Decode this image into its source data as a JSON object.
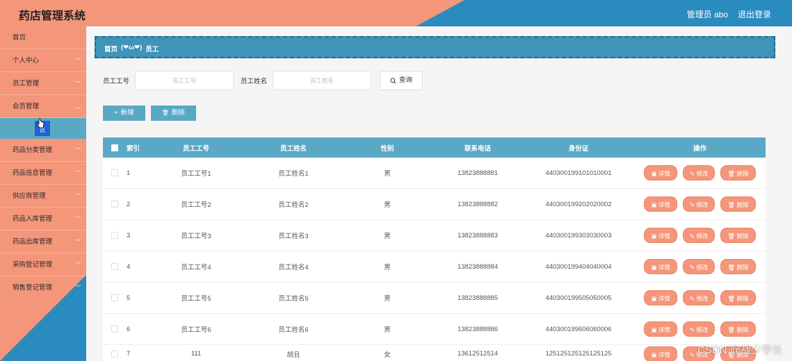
{
  "app": {
    "title": "药店管理系统"
  },
  "header": {
    "user_label": "管理员 abo",
    "logout_label": "退出登录"
  },
  "sidebar": {
    "items": [
      {
        "label": "首页",
        "has_children": false
      },
      {
        "label": "个人中心",
        "has_children": true
      },
      {
        "label": "员工管理",
        "has_children": true
      },
      {
        "label": "会员管理",
        "has_children": true
      },
      {
        "label": "药品分类管理",
        "has_children": true
      },
      {
        "label": "药品信息管理",
        "has_children": true
      },
      {
        "label": "供应商管理",
        "has_children": true
      },
      {
        "label": "药品入库管理",
        "has_children": true
      },
      {
        "label": "药品出库管理",
        "has_children": true
      },
      {
        "label": "采购登记管理",
        "has_children": true
      },
      {
        "label": "销售登记管理",
        "has_children": true
      }
    ],
    "active_sub_label": "员"
  },
  "breadcrumb": {
    "home": "首页",
    "separator": "(❤ω❤)",
    "current": "员工"
  },
  "search": {
    "no_label": "员工工号",
    "no_placeholder": "员工工号",
    "name_label": "员工姓名",
    "name_placeholder": "员工姓名",
    "button_icon": "search-icon",
    "button_label": "查询"
  },
  "actions": {
    "add_label": "新增",
    "add_icon": "+",
    "delete_label": "删除",
    "delete_icon": "🗑"
  },
  "table": {
    "columns": [
      "索引",
      "员工工号",
      "员工姓名",
      "性别",
      "联系电话",
      "身份证",
      "操作"
    ],
    "rows": [
      {
        "idx": "1",
        "no": "员工工号1",
        "name": "员工姓名1",
        "sex": "男",
        "tel": "13823888881",
        "id": "440300199101010001"
      },
      {
        "idx": "2",
        "no": "员工工号2",
        "name": "员工姓名2",
        "sex": "男",
        "tel": "13823888882",
        "id": "440300199202020002"
      },
      {
        "idx": "3",
        "no": "员工工号3",
        "name": "员工姓名3",
        "sex": "男",
        "tel": "13823888883",
        "id": "440300199303030003"
      },
      {
        "idx": "4",
        "no": "员工工号4",
        "name": "员工姓名4",
        "sex": "男",
        "tel": "13823888884",
        "id": "440300199404040004"
      },
      {
        "idx": "5",
        "no": "员工工号5",
        "name": "员工姓名5",
        "sex": "男",
        "tel": "13823888885",
        "id": "440300199505050005"
      },
      {
        "idx": "6",
        "no": "员工工号6",
        "name": "员工姓名6",
        "sex": "男",
        "tel": "13823888886",
        "id": "440300199606060006"
      },
      {
        "idx": "7",
        "no": "111",
        "name": "胡且",
        "sex": "女",
        "tel": "13612512514",
        "id": "125125125125125125"
      }
    ],
    "op_detail": "详情",
    "op_edit": "修改",
    "op_delete": "删除"
  },
  "colors": {
    "salmon": "#f4967a",
    "blue": "#3f94b8",
    "light_blue": "#5aa8c6",
    "deep_blue": "#2a8bbf"
  },
  "watermark": "CSDN @战少学长"
}
